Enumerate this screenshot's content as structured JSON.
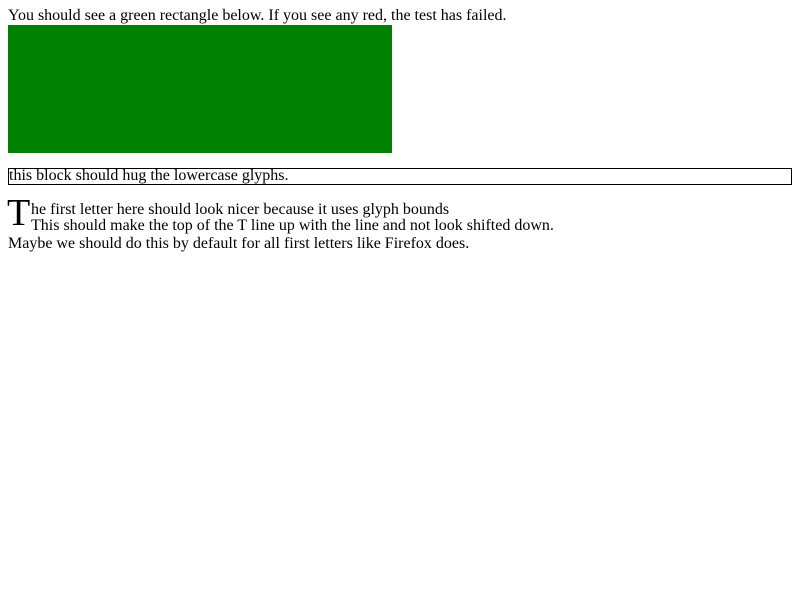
{
  "intro_text": "You should see a green rectangle below. If you see any red, the test has failed.",
  "green_rectangle_color": "#008000",
  "hug_block_text": "this block should hug the lowercase glyphs.",
  "first_letter": {
    "letter": "T",
    "line1_rest": "he first letter here should look nicer because it uses glyph bounds",
    "line2": "This should make the top of the T line up with the line and not look shifted down.",
    "line3": "Maybe we should do this by default for all first letters like Firefox does."
  }
}
